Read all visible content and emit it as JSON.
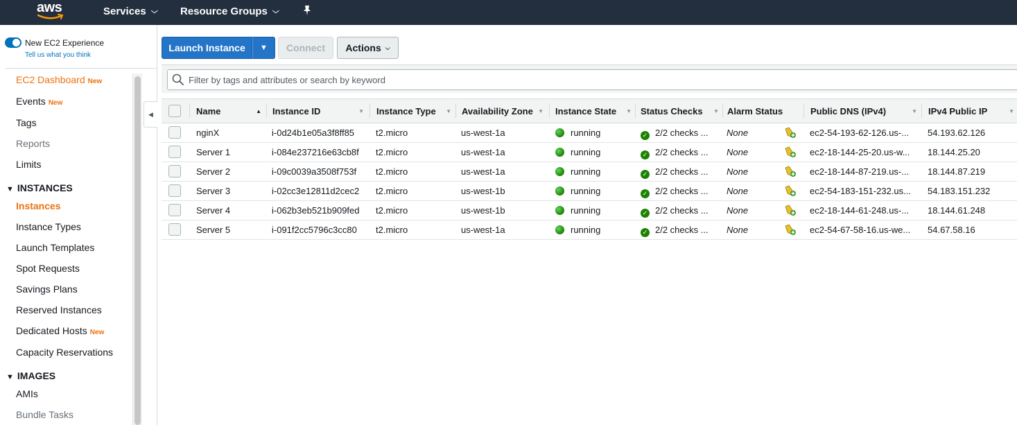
{
  "topbar": {
    "logo_text": "aws",
    "services_label": "Services",
    "resource_groups_label": "Resource Groups"
  },
  "sidebar": {
    "new_experience_label": "New EC2 Experience",
    "tell_us_label": "Tell us what you think",
    "badge_new": "New",
    "items": {
      "dashboard": "EC2 Dashboard",
      "events": "Events",
      "tags": "Tags",
      "reports": "Reports",
      "limits": "Limits",
      "instances_section": "INSTANCES",
      "instances": "Instances",
      "instance_types": "Instance Types",
      "launch_templates": "Launch Templates",
      "spot_requests": "Spot Requests",
      "savings_plans": "Savings Plans",
      "reserved_instances": "Reserved Instances",
      "dedicated_hosts": "Dedicated Hosts",
      "capacity_reservations": "Capacity Reservations",
      "images_section": "IMAGES",
      "amis": "AMIs",
      "bundle_tasks": "Bundle Tasks"
    }
  },
  "toolbar": {
    "launch_label": "Launch Instance",
    "connect_label": "Connect",
    "actions_label": "Actions"
  },
  "filter": {
    "placeholder": "Filter by tags and attributes or search by keyword"
  },
  "table": {
    "columns": {
      "name": "Name",
      "instance_id": "Instance ID",
      "instance_type": "Instance Type",
      "az": "Availability Zone",
      "state": "Instance State",
      "checks": "Status Checks",
      "alarm": "Alarm Status",
      "dns": "Public DNS (IPv4)",
      "ip": "IPv4 Public IP"
    },
    "rows": [
      {
        "name": "nginX",
        "id": "i-0d24b1e05a3f8ff85",
        "type": "t2.micro",
        "az": "us-west-1a",
        "state": "running",
        "checks": "2/2 checks ...",
        "alarm": "None",
        "dns": "ec2-54-193-62-126.us-...",
        "ip": "54.193.62.126"
      },
      {
        "name": "Server 1",
        "id": "i-084e237216e63cb8f",
        "type": "t2.micro",
        "az": "us-west-1a",
        "state": "running",
        "checks": "2/2 checks ...",
        "alarm": "None",
        "dns": "ec2-18-144-25-20.us-w...",
        "ip": "18.144.25.20"
      },
      {
        "name": "Server 2",
        "id": "i-09c0039a3508f753f",
        "type": "t2.micro",
        "az": "us-west-1a",
        "state": "running",
        "checks": "2/2 checks ...",
        "alarm": "None",
        "dns": "ec2-18-144-87-219.us-...",
        "ip": "18.144.87.219"
      },
      {
        "name": "Server 3",
        "id": "i-02cc3e12811d2cec2",
        "type": "t2.micro",
        "az": "us-west-1b",
        "state": "running",
        "checks": "2/2 checks ...",
        "alarm": "None",
        "dns": "ec2-54-183-151-232.us...",
        "ip": "54.183.151.232"
      },
      {
        "name": "Server 4",
        "id": "i-062b3eb521b909fed",
        "type": "t2.micro",
        "az": "us-west-1b",
        "state": "running",
        "checks": "2/2 checks ...",
        "alarm": "None",
        "dns": "ec2-18-144-61-248.us-...",
        "ip": "18.144.61.248"
      },
      {
        "name": "Server 5",
        "id": "i-091f2cc5796c3cc80",
        "type": "t2.micro",
        "az": "us-west-1a",
        "state": "running",
        "checks": "2/2 checks ...",
        "alarm": "None",
        "dns": "ec2-54-67-58-16.us-we...",
        "ip": "54.67.58.16"
      }
    ]
  },
  "colors": {
    "topbar": "#232f3e",
    "accent_orange": "#ec7211",
    "primary_blue": "#2475c7",
    "running_green": "#1d8102"
  }
}
